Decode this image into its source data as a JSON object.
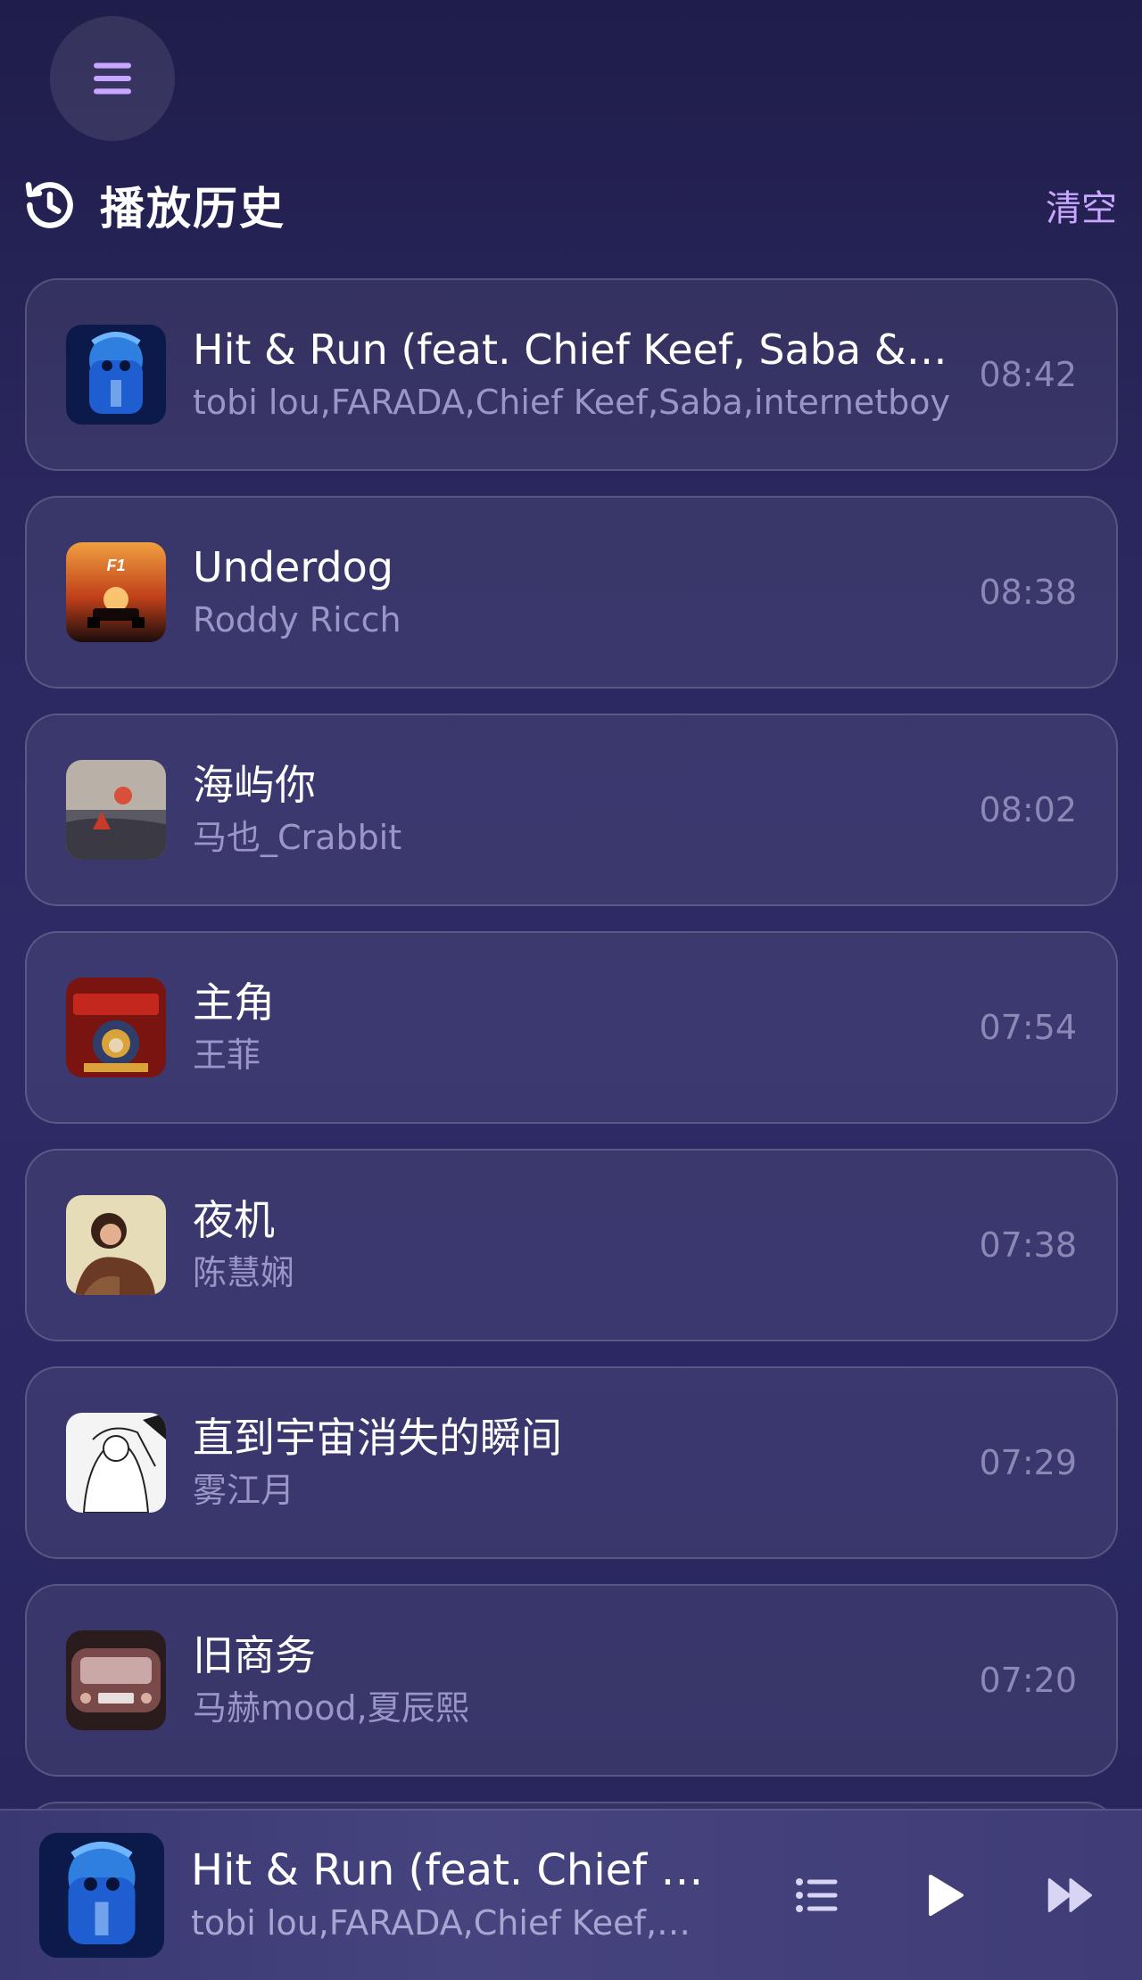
{
  "header": {
    "title": "播放历史",
    "clear_label": "清空"
  },
  "history": [
    {
      "title": "Hit & Run (feat. Chief Keef, Saba & internetboy)",
      "artist": "tobi lou,FARADA,Chief Keef,Saba,internetboy",
      "time": "08:42"
    },
    {
      "title": "Underdog",
      "artist": "Roddy Ricch",
      "time": "08:38"
    },
    {
      "title": "海屿你",
      "artist": "马也_Crabbit",
      "time": "08:02"
    },
    {
      "title": "主角",
      "artist": "王菲",
      "time": "07:54"
    },
    {
      "title": "夜机",
      "artist": "陈慧娴",
      "time": "07:38"
    },
    {
      "title": "直到宇宙消失的瞬间",
      "artist": "雾江月",
      "time": "07:29"
    },
    {
      "title": "旧商务",
      "artist": "马赫mood,夏辰熙",
      "time": "07:20"
    }
  ],
  "player": {
    "title": "Hit & Run (feat. Chief Keef, Saba & internetboy)",
    "artist": "tobi lou,FARADA,Chief Keef,Saba,internetboy"
  },
  "colors": {
    "accent": "#c9a6ff",
    "background": "#2a275e"
  }
}
